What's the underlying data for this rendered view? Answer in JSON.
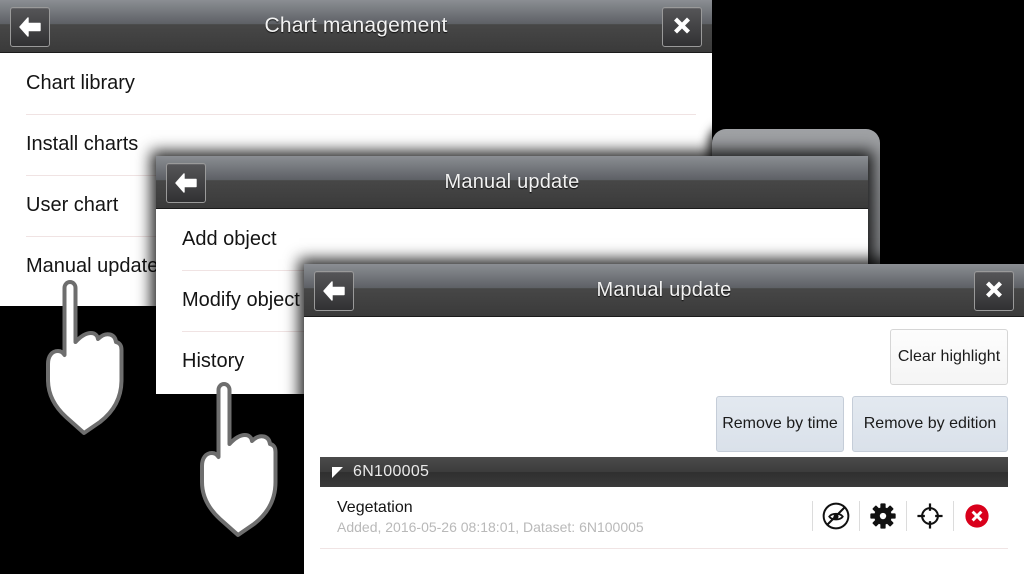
{
  "background": {
    "color": "#000000"
  },
  "theme": {
    "titlebar_top": "#8b8e93",
    "titlebar_bottom": "#3a3a3a",
    "title_text": "#f2f2f2",
    "menu_background": "#ffffff",
    "separator": "#f0e3e3",
    "button_bluish": "#dde3ea",
    "button_light": "#f7f7f7",
    "delete_red": "#d9001b",
    "group_header": "#3c3c3c"
  },
  "dialogs": {
    "chart_management": {
      "title": "Chart management",
      "back_icon": "back-arrow-icon",
      "close_icon": "close-x-icon",
      "items": [
        {
          "label": "Chart library"
        },
        {
          "label": "Install charts"
        },
        {
          "label": "User chart"
        },
        {
          "label": "Manual update"
        }
      ]
    },
    "manual_update_menu": {
      "title": "Manual update",
      "back_icon": "back-arrow-icon",
      "items": [
        {
          "label": "Add object"
        },
        {
          "label": "Modify object"
        },
        {
          "label": "History"
        }
      ]
    },
    "manual_update_history": {
      "title": "Manual update",
      "back_icon": "back-arrow-icon",
      "close_icon": "close-x-icon",
      "buttons": {
        "clear_highlight": "Clear highlight",
        "remove_by_time": "Remove by time",
        "remove_by_edition": "Remove by edition"
      },
      "group": {
        "label": "6N100005",
        "expanded": true
      },
      "records": [
        {
          "title": "Vegetation",
          "detail": "Added,  2016-05-26  08:18:01, Dataset: 6N100005",
          "actions": [
            {
              "icon": "hide-eye-icon"
            },
            {
              "icon": "gear-icon"
            },
            {
              "icon": "target-crosshair-icon"
            },
            {
              "icon": "delete-red-x-icon"
            }
          ]
        }
      ]
    }
  },
  "cursors": [
    {
      "name": "pointing-hand-cursor-manual-update",
      "target": "Manual update"
    },
    {
      "name": "pointing-hand-cursor-history",
      "target": "History"
    }
  ]
}
